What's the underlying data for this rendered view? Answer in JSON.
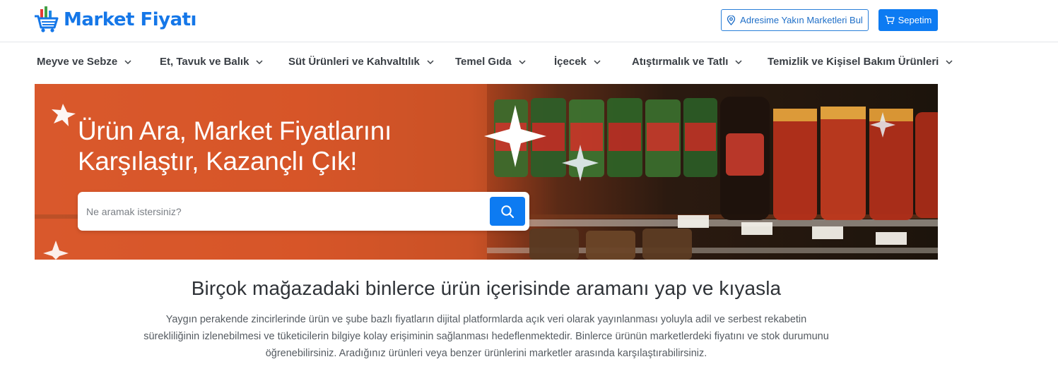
{
  "brand": {
    "name": "Market Fiyatı",
    "logo_icon": "cart-with-bars-icon"
  },
  "header": {
    "find_stores_label": "Adresime Yakın Marketleri Bul",
    "find_stores_icon": "map-pin-icon",
    "cart_label": "Sepetim",
    "cart_icon": "shopping-cart-icon"
  },
  "categories": [
    {
      "label": "Meyve ve Sebze"
    },
    {
      "label": "Et, Tavuk ve Balık"
    },
    {
      "label": "Süt Ürünleri ve Kahvaltılık"
    },
    {
      "label": "Temel Gıda"
    },
    {
      "label": "İçecek"
    },
    {
      "label": "Atıştırmalık ve Tatlı"
    },
    {
      "label": "Temizlik ve Kişisel Bakım Ürünleri"
    }
  ],
  "hero": {
    "title_line1": "Ürün Ara, Market Fiyatlarını",
    "title_line2": "Karşılaştır, Kazançlı Çık!",
    "search_placeholder": "Ne aramak istersiniz?",
    "search_icon": "search-icon"
  },
  "intro": {
    "headline": "Birçok mağazadaki binlerce ürün içerisinde aramanı yap ve kıyasla",
    "line1": "Yaygın perakende zincirlerinde ürün ve şube bazlı fiyatların dijital platformlarda açık veri olarak yayınlanması yoluyla adil ve serbest rekabetin",
    "line2": "sürekliliğinin izlenebilmesi ve tüketicilerin bilgiye kolay erişiminin sağlanması hedeflenmektedir. Binlerce ürünün marketlerdeki fiyatını ve stok durumunu",
    "line3": "öğrenebilirsiniz. Aradığınız ürünleri veya benzer ürünlerini marketler arasında karşılaştırabilirsiniz."
  },
  "colors": {
    "brand_blue": "#1577e8",
    "button_blue": "#0d7bf2",
    "hero_orange": "#d4532a"
  }
}
